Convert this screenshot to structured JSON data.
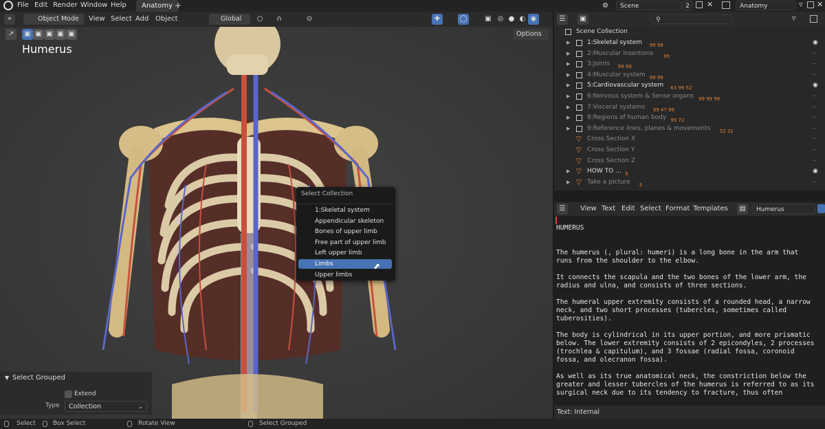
{
  "menubar": {
    "items": [
      "File",
      "Edit",
      "Render",
      "Window",
      "Help"
    ],
    "workspace_tab": "Anatomy",
    "add_tab": "+",
    "scene": "Scene",
    "scene_users": "2",
    "view_layer": "Anatomy"
  },
  "viewport_header": {
    "mode": "Object Mode",
    "menus": [
      "View",
      "Select",
      "Add",
      "Object"
    ],
    "orientation": "Global",
    "options": "Options"
  },
  "viewport": {
    "object_name": "Humerus"
  },
  "popup": {
    "title": "Select Collection",
    "items": [
      "1:Skeletal system",
      "Appendicular skeleton",
      "Bones of upper limb",
      "Free part of upper limb",
      "Left upper limb",
      "Limbs",
      "Upper limbs"
    ],
    "highlighted_index": 5
  },
  "operator_panel": {
    "title": "Select Grouped",
    "extend_label": "Extend",
    "type_label": "Type",
    "type_value": "Collection"
  },
  "outliner": {
    "root": "Scene Collection",
    "rows": [
      {
        "label": "1:Skeletal system",
        "dim": false,
        "badges": "99 99"
      },
      {
        "label": "2:Muscular insertions",
        "dim": true,
        "badges": "99"
      },
      {
        "label": "3:Joints",
        "dim": true,
        "badges": "99 99"
      },
      {
        "label": "4:Muscular system",
        "dim": true,
        "badges": "99 99"
      },
      {
        "label": "5:Cardiovascular system",
        "dim": false,
        "badges": "63 99 52"
      },
      {
        "label": "6:Nervous system & Sense organs",
        "dim": true,
        "badges": "99 99 99"
      },
      {
        "label": "7:Visceral systems",
        "dim": true,
        "badges": "99 47 99"
      },
      {
        "label": "8:Regions of human body",
        "dim": true,
        "badges": "99 72"
      },
      {
        "label": "9:Reference lines, planes & movements",
        "dim": true,
        "badges": "52 31"
      },
      {
        "label": "Cross Section X",
        "dim": true,
        "badges": ""
      },
      {
        "label": "Cross Section Y",
        "dim": true,
        "badges": ""
      },
      {
        "label": "Cross Section Z",
        "dim": true,
        "badges": ""
      },
      {
        "label": "HOW TO ...",
        "dim": false,
        "badges": "9"
      },
      {
        "label": "Take a picture",
        "dim": true,
        "badges": "3"
      }
    ]
  },
  "text_editor": {
    "menus": [
      "View",
      "Text",
      "Edit",
      "Select",
      "Format",
      "Templates"
    ],
    "text_name": "Humerus",
    "footer": "Text: Internal",
    "lines": [
      "",
      "HUMERUS",
      "",
      "",
      "The humerus (, plural: humeri) is a long bone in the arm that",
      "runs from the shoulder to the elbow.",
      "",
      "It connects the scapula and the two bones of the lower arm, the",
      "radius and ulna, and consists of three sections.",
      "",
      "The humeral upper extremity consists of a rounded head, a narrow",
      "neck, and two short processes (tubercles, sometimes called",
      "tuberosities).",
      "",
      "The body is cylindrical in its upper portion, and more prismatic",
      "below. The lower extremity consists of 2 epicondyles, 2 processes",
      "(trochlea & capitulum), and 3 fossae (radial fossa, coronoid",
      "fossa, and olecranon fossa).",
      "",
      "As well as its true anatomical neck, the constriction below the",
      "greater and lesser tubercles of the humerus is referred to as its",
      "surgical neck due to its tendency to fracture, thus often"
    ]
  },
  "statusbar": {
    "items": [
      "Select",
      "Box Select",
      "Rotate View",
      "Select Grouped"
    ]
  },
  "colors": {
    "accent": "#4772b3",
    "bone": "#d8c08a",
    "artery": "#c8503c",
    "vein": "#5a66c8"
  }
}
